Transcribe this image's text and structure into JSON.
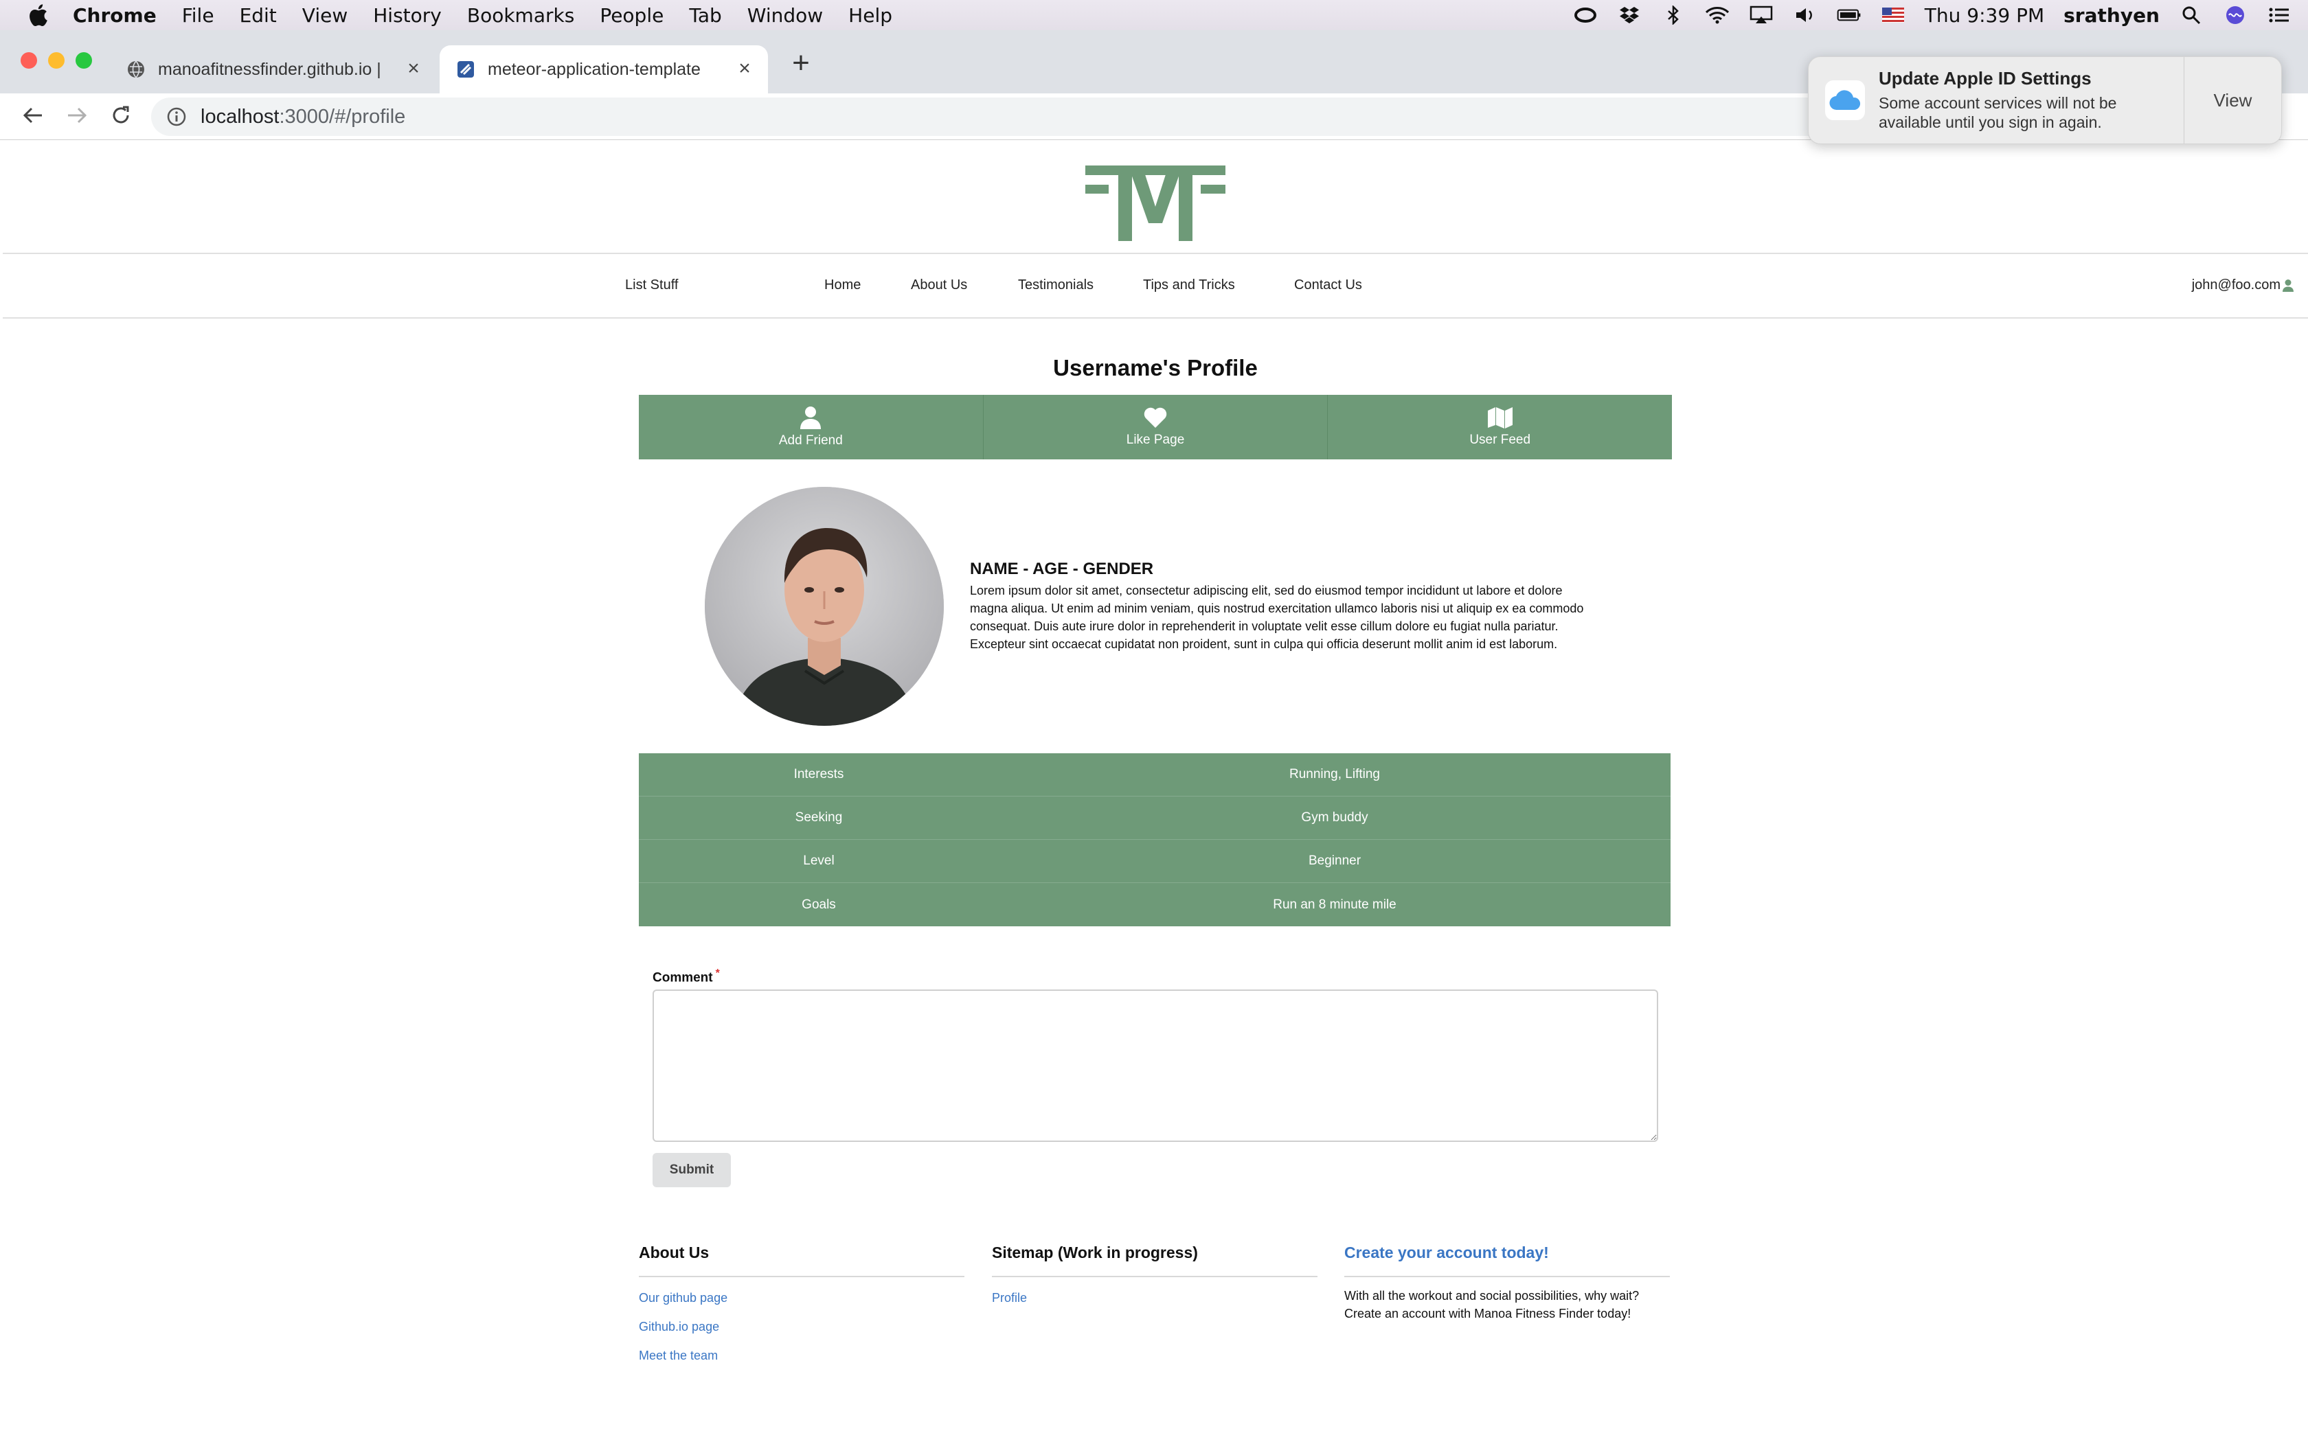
{
  "menubar": {
    "app": "Chrome",
    "items": [
      "File",
      "Edit",
      "View",
      "History",
      "Bookmarks",
      "People",
      "Tab",
      "Window",
      "Help"
    ],
    "clock": "Thu 9:39 PM",
    "user": "srathyen"
  },
  "browser": {
    "tabs": [
      {
        "title": "manoafitnessfinder.github.io |",
        "active": false
      },
      {
        "title": "meteor-application-template",
        "active": true
      }
    ],
    "url_host": "localhost",
    "url_rest": ":3000/#/profile"
  },
  "notification": {
    "title": "Update Apple ID Settings",
    "body_line1": "Some account services will not be",
    "body_line2": "available until you sign in again.",
    "action": "View"
  },
  "nav": {
    "list_stuff": "List Stuff",
    "home": "Home",
    "about": "About Us",
    "testimonials": "Testimonials",
    "tips": "Tips and Tricks",
    "contact": "Contact Us",
    "user": "john@foo.com"
  },
  "profile": {
    "title": "Username's Profile",
    "actions": {
      "add_friend": "Add Friend",
      "like_page": "Like Page",
      "user_feed": "User Feed"
    },
    "name_line": "NAME - AGE - GENDER",
    "bio": "Lorem ipsum dolor sit amet, consectetur adipiscing elit, sed do eiusmod tempor incididunt ut labore et dolore magna aliqua. Ut enim ad minim veniam, quis nostrud exercitation ullamco laboris nisi ut aliquip ex ea commodo consequat. Duis aute irure dolor in reprehenderit in voluptate velit esse cillum dolore eu fugiat nulla pariatur. Excepteur sint occaecat cupidatat non proident, sunt in culpa qui officia deserunt mollit anim id est laborum.",
    "details": [
      {
        "key": "Interests",
        "value": "Running, Lifting"
      },
      {
        "key": "Seeking",
        "value": "Gym buddy"
      },
      {
        "key": "Level",
        "value": "Beginner"
      },
      {
        "key": "Goals",
        "value": "Run an 8 minute mile"
      }
    ]
  },
  "form": {
    "comment_label": "Comment",
    "required_mark": "*",
    "comment_value": "",
    "submit_label": "Submit"
  },
  "footer": {
    "about": {
      "heading": "About Us",
      "links": [
        "Our github page",
        "Github.io page",
        "Meet the team"
      ]
    },
    "sitemap": {
      "heading": "Sitemap (Work in progress)",
      "links": [
        "Profile"
      ]
    },
    "cta": {
      "heading": "Create your account today!",
      "line1": "With all the workout and social possibilities, why wait?",
      "line2": "Create an account with Manoa Fitness Finder today!"
    }
  },
  "colors": {
    "brand_green": "#6e9a78",
    "link_blue": "#3a76c4"
  }
}
